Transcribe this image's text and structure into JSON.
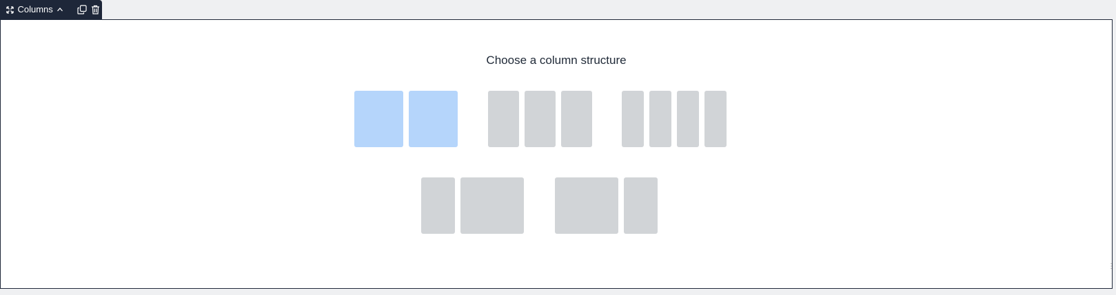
{
  "toolbar": {
    "block_label": "Columns",
    "icons": {
      "move": "move-icon",
      "collapse": "chevron-up-icon",
      "duplicate": "duplicate-icon",
      "delete": "trash-icon"
    }
  },
  "panel": {
    "title": "Choose a column structure",
    "options": [
      {
        "name": "two-equal",
        "columns": 2,
        "selected": true
      },
      {
        "name": "three-equal",
        "columns": 3,
        "selected": false
      },
      {
        "name": "four-equal",
        "columns": 4,
        "selected": false
      },
      {
        "name": "narrow-wide",
        "columns": 2,
        "selected": false
      },
      {
        "name": "wide-narrow",
        "columns": 2,
        "selected": false
      }
    ]
  },
  "colors": {
    "toolbar_bg": "#1e2739",
    "selected_column": "#b5d5fb",
    "column": "#d1d4d7"
  }
}
